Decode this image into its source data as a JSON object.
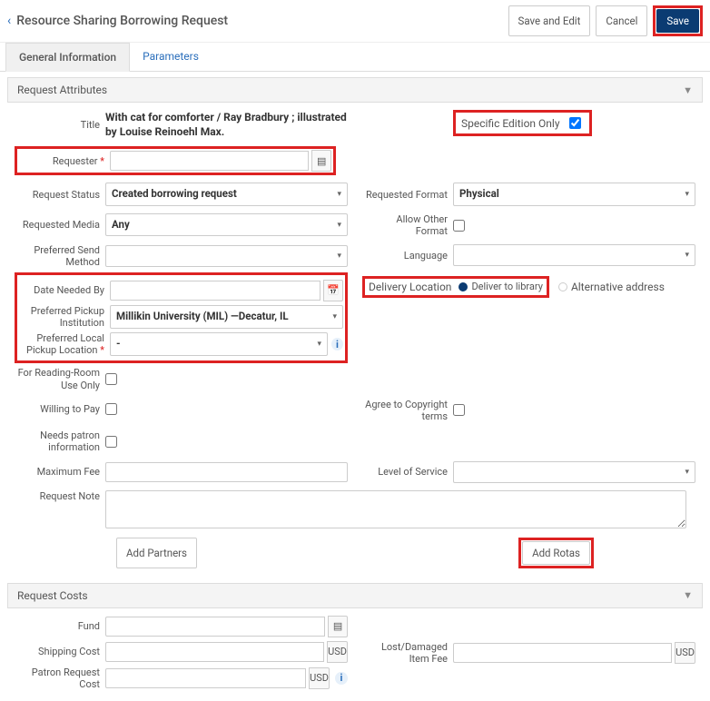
{
  "header": {
    "title": "Resource Sharing Borrowing Request",
    "actions": {
      "save_edit": "Save and Edit",
      "cancel": "Cancel",
      "save": "Save"
    }
  },
  "tabs": {
    "general": "General Information",
    "parameters": "Parameters"
  },
  "section_attributes": "Request Attributes",
  "attrs": {
    "title_label": "Title",
    "title_value": "With cat for comforter / Ray Bradbury ; illustrated by Louise Reinoehl Max.",
    "specific_edition_label": "Specific Edition Only",
    "requester_label": "Requester",
    "request_status_label": "Request Status",
    "request_status_value": "Created borrowing request",
    "requested_media_label": "Requested Media",
    "requested_media_value": "Any",
    "preferred_send_label": "Preferred Send Method",
    "date_needed_label": "Date Needed By",
    "pickup_inst_label": "Preferred Pickup Institution",
    "pickup_inst_value": "Millikin University (MIL) —Decatur, IL",
    "local_pickup_label": "Preferred Local Pickup Location",
    "local_pickup_value": "-",
    "reading_room_label": "For Reading-Room Use Only",
    "willing_pay_label": "Willing to Pay",
    "needs_patron_label": "Needs patron information",
    "max_fee_label": "Maximum Fee",
    "request_note_label": "Request Note",
    "requested_format_label": "Requested Format",
    "requested_format_value": "Physical",
    "allow_other_label": "Allow Other Format",
    "language_label": "Language",
    "delivery_location_label": "Delivery Location",
    "deliver_to_library": "Deliver to library",
    "alternative_address": "Alternative address",
    "agree_copyright_label": "Agree to Copyright terms",
    "level_service_label": "Level of Service",
    "add_partners": "Add Partners",
    "add_rotas": "Add Rotas"
  },
  "section_costs": "Request Costs",
  "costs": {
    "fund_label": "Fund",
    "shipping_label": "Shipping Cost",
    "patron_req_label": "Patron Request Cost",
    "lost_fee_label": "Lost/Damaged Item Fee",
    "currency": "USD"
  }
}
